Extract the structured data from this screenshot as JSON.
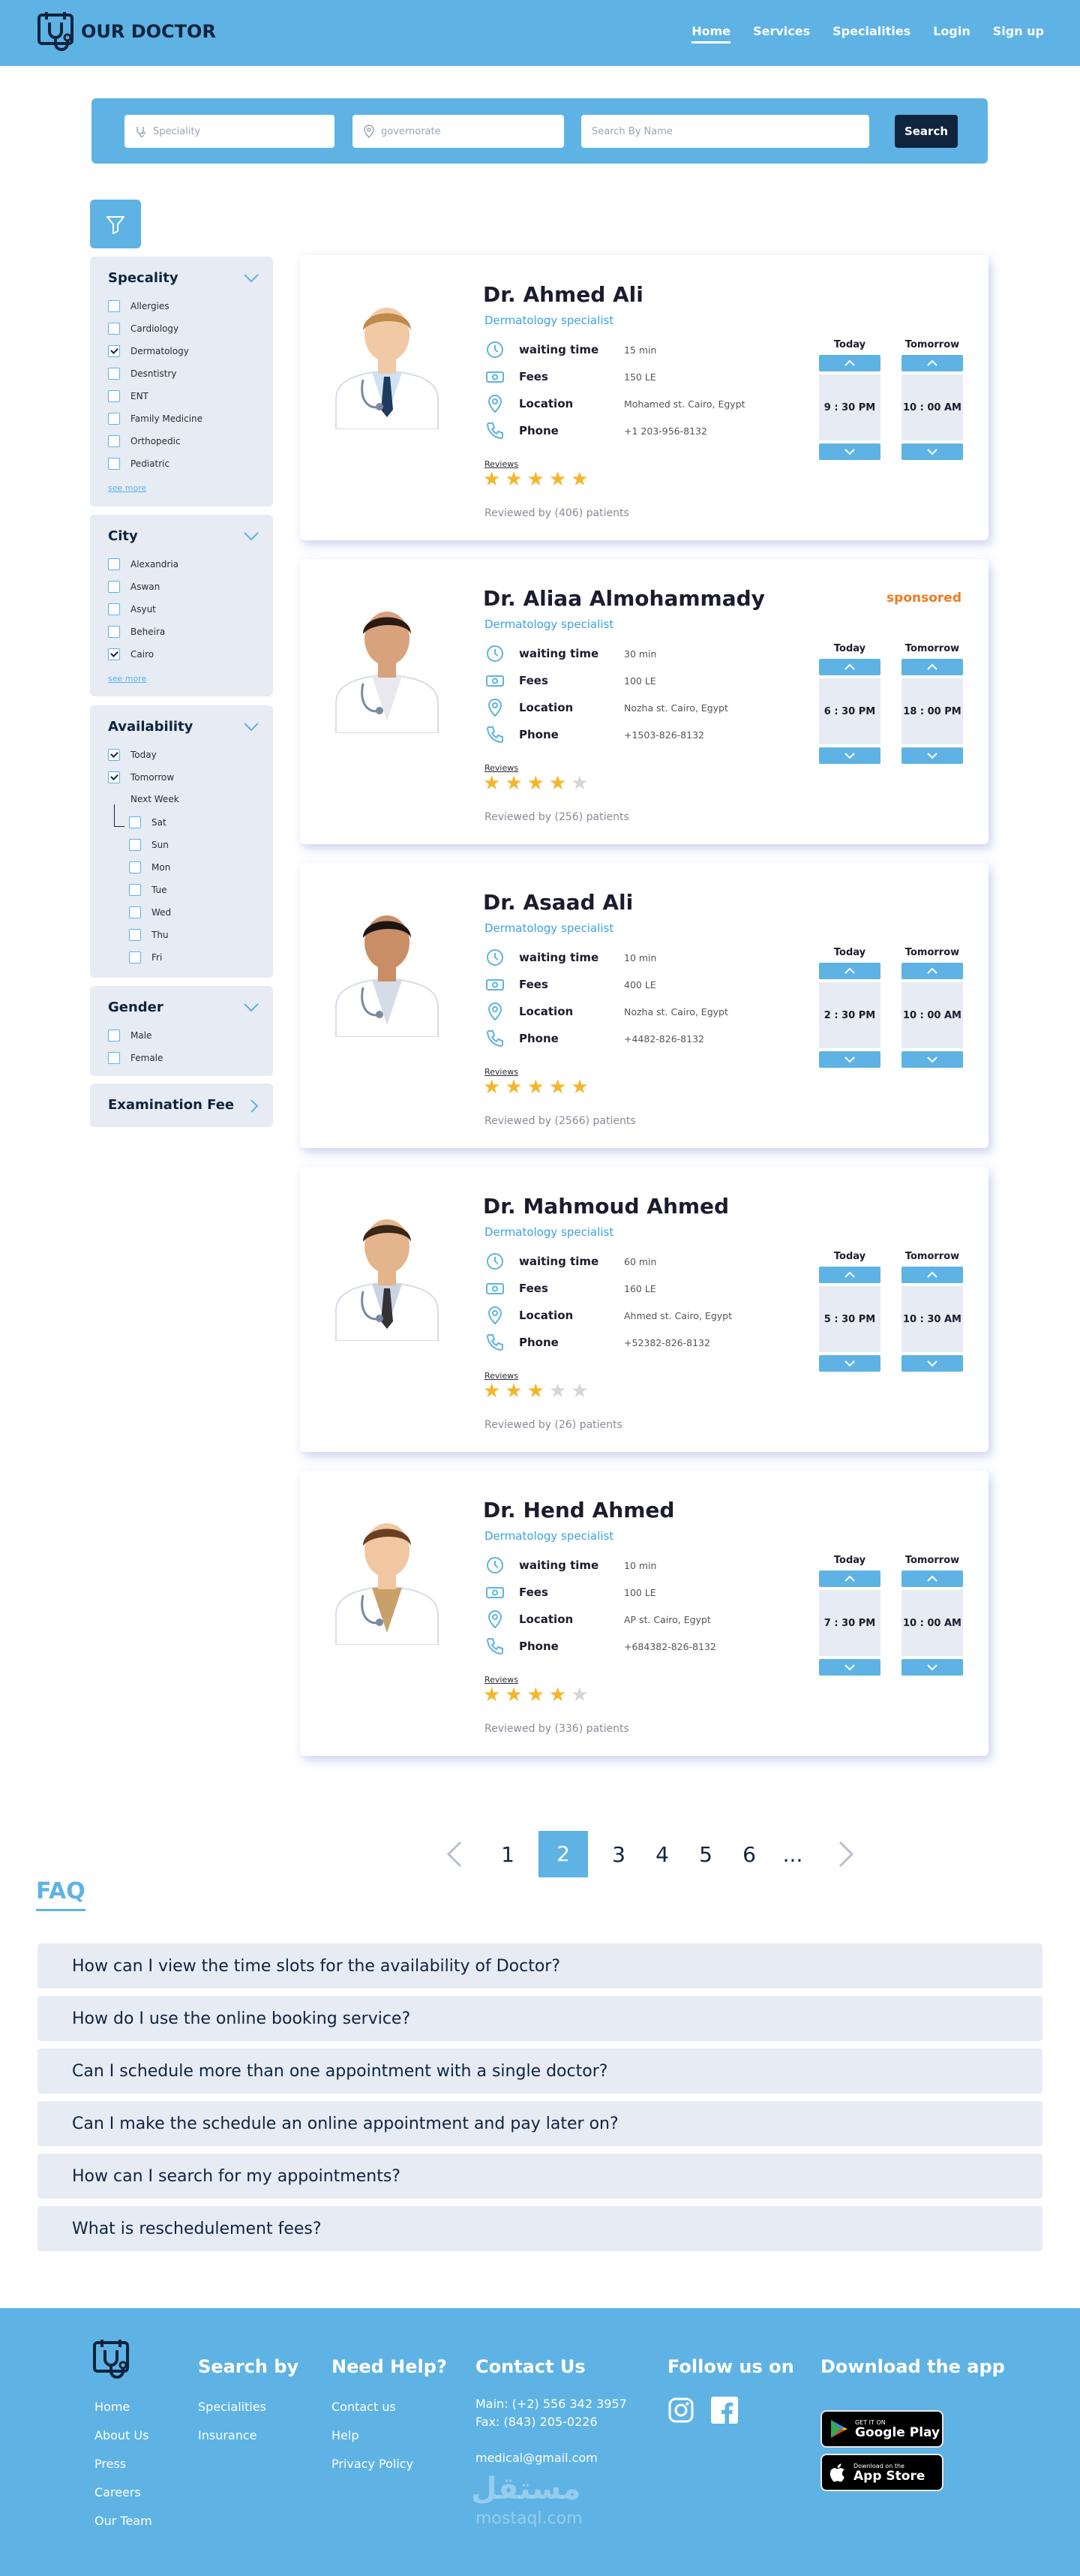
{
  "header": {
    "logo": "OUR DOCTOR",
    "nav": [
      "Home",
      "Services",
      "Specialities",
      "Login",
      "Sign up"
    ]
  },
  "search": {
    "speciality_placeholder": "Speciality",
    "governorate_placeholder": "governorate",
    "name_placeholder": "Search By Name",
    "button": "Search"
  },
  "filters": {
    "speciality": {
      "title": "Specality",
      "options": [
        "Allergies",
        "Cardiology",
        "Dermatology",
        "Desntistry",
        "ENT",
        "Family Medicine",
        "Orthopedic",
        "Pediatric"
      ],
      "checked": [
        false,
        false,
        true,
        false,
        false,
        false,
        false,
        false
      ],
      "see_more": "see more"
    },
    "city": {
      "title": "City",
      "options": [
        "Alexandria",
        "Aswan",
        "Asyut",
        "Beheira",
        "Cairo"
      ],
      "checked": [
        false,
        false,
        false,
        false,
        true
      ],
      "see_more": "see more"
    },
    "availability": {
      "title": "Availability",
      "options": [
        "Today",
        "Tomorrow"
      ],
      "checked": [
        true,
        true
      ],
      "next_week": "Next Week",
      "days": [
        "Sat",
        "Sun",
        "Mon",
        "Tue",
        "Wed",
        "Thu",
        "Fri"
      ]
    },
    "gender": {
      "title": "Gender",
      "options": [
        "Male",
        "Female"
      ]
    },
    "fee": {
      "title": "Examination Fee"
    }
  },
  "labels": {
    "waiting": "waiting time",
    "fees": "Fees",
    "location": "Location",
    "phone": "Phone",
    "reviews": "Reviews",
    "today": "Today",
    "tomorrow": "Tomorrow"
  },
  "doctors": [
    {
      "name": "Dr. Ahmed Ali",
      "specialty": "Dermatology specialist",
      "waiting": "15 min",
      "fees": "150 LE",
      "location": "Mohamed st. Cairo, Egypt",
      "phone": "+1 203-956-8132",
      "rating": 5,
      "reviewed": "Reviewed by (406) patients",
      "today": "9 : 30 PM",
      "tomorrow": "10 : 00 AM",
      "sponsored": ""
    },
    {
      "name": "Dr. Aliaa Almohammady",
      "specialty": "Dermatology specialist",
      "waiting": "30 min",
      "fees": "100 LE",
      "location": "Nozha st. Cairo, Egypt",
      "phone": "+1503-826-8132",
      "rating": 4,
      "reviewed": "Reviewed by (256) patients",
      "today": "6 : 30 PM",
      "tomorrow": "18 : 00 PM",
      "sponsored": "sponsored"
    },
    {
      "name": "Dr. Asaad Ali",
      "specialty": "Dermatology specialist",
      "waiting": "10 min",
      "fees": "400 LE",
      "location": "Nozha st. Cairo, Egypt",
      "phone": "+4482-826-8132",
      "rating": 5,
      "reviewed": "Reviewed by (2566) patients",
      "today": "2 : 30 PM",
      "tomorrow": "10 : 00 AM",
      "sponsored": ""
    },
    {
      "name": "Dr. Mahmoud Ahmed",
      "specialty": "Dermatology specialist",
      "waiting": "60 min",
      "fees": "160 LE",
      "location": "Ahmed st. Cairo, Egypt",
      "phone": "+52382-826-8132",
      "rating": 3,
      "reviewed": "Reviewed by (26) patients",
      "today": "5 : 30 PM",
      "tomorrow": "10 : 30 AM",
      "sponsored": ""
    },
    {
      "name": "Dr. Hend Ahmed",
      "specialty": "Dermatology specialist",
      "waiting": "10 min",
      "fees": "100 LE",
      "location": "AP st. Cairo, Egypt",
      "phone": "+684382-826-8132",
      "rating": 4,
      "reviewed": "Reviewed by (336) patients",
      "today": "7 : 30 PM",
      "tomorrow": "10 : 00 AM",
      "sponsored": ""
    }
  ],
  "pagination": {
    "pages": [
      "1",
      "2",
      "3",
      "4",
      "5",
      "6",
      "..."
    ],
    "active": "2"
  },
  "faq": {
    "title": "FAQ",
    "items": [
      "How can I view the time slots for the availability of Doctor?",
      "How do I use the online booking service?",
      "Can I schedule more than one appointment with a single doctor?",
      "Can I make the schedule an online appointment and pay later on?",
      "How can I search for my appointments?",
      "What is reschedulement fees?"
    ]
  },
  "footer": {
    "links_main": [
      "Home",
      "About Us",
      "Press",
      "Careers",
      "Our Team"
    ],
    "search_by": {
      "title": "Search by",
      "links": [
        "Specialities",
        "Insurance"
      ]
    },
    "help": {
      "title": "Need Help?",
      "links": [
        "Contact us",
        "Help",
        "Privacy Policy"
      ]
    },
    "contact": {
      "title": "Contact Us",
      "main": "Main: (+2) 556 342 3957",
      "fax": "Fax: (843) 205-0226",
      "email": "medical@gmail.com"
    },
    "follow": {
      "title": "Follow us on"
    },
    "download": {
      "title": "Download the app",
      "google_small": "GET IT ON",
      "google_big": "Google Play",
      "apple_small": "Download on the",
      "apple_big": "App Store"
    },
    "watermark": "مستقل",
    "watermark_sub": "mostaql.com"
  },
  "colors": {
    "primary": "#5eb3e4",
    "dark": "#10243e",
    "panel": "#e6ebf4",
    "star": "#f4b62a",
    "sponsored": "#f07b1e"
  }
}
